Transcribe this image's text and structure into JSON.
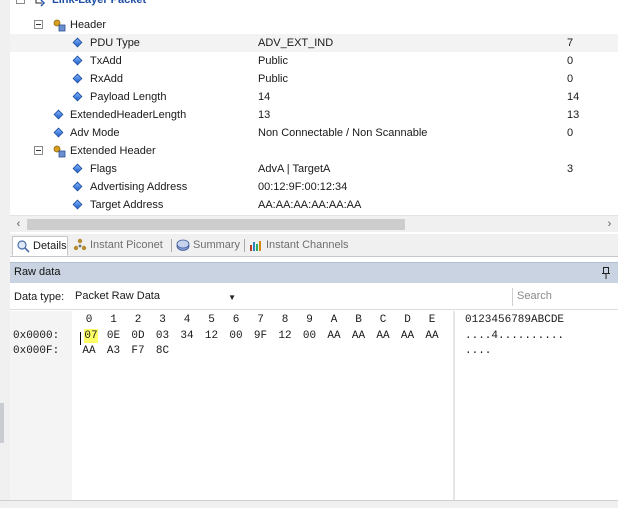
{
  "tree": {
    "title": "Link-Layer Packet",
    "rows": [
      {
        "id": "header",
        "name": "Header",
        "value": "",
        "raw": ""
      },
      {
        "id": "pdu-type",
        "name": "PDU Type",
        "value": "ADV_EXT_IND",
        "raw": "7"
      },
      {
        "id": "txadd",
        "name": "TxAdd",
        "value": "Public",
        "raw": "0"
      },
      {
        "id": "rxadd",
        "name": "RxAdd",
        "value": "Public",
        "raw": "0"
      },
      {
        "id": "payload-length",
        "name": "Payload Length",
        "value": "14",
        "raw": "14"
      },
      {
        "id": "ext-header-length",
        "name": "ExtendedHeaderLength",
        "value": "13",
        "raw": "13"
      },
      {
        "id": "adv-mode",
        "name": "Adv Mode",
        "value": "Non Connectable / Non Scannable",
        "raw": "0"
      },
      {
        "id": "extended-header",
        "name": "Extended Header",
        "value": "",
        "raw": ""
      },
      {
        "id": "flags",
        "name": "Flags",
        "value": "AdvA | TargetA",
        "raw": "3"
      },
      {
        "id": "advertising-address",
        "name": "Advertising Address",
        "value": "00:12:9F:00:12:34",
        "raw": ""
      },
      {
        "id": "target-address",
        "name": "Target Address",
        "value": "AA:AA:AA:AA:AA:AA",
        "raw": ""
      }
    ]
  },
  "scroll": {
    "left_arrow": "‹",
    "right_arrow": "›"
  },
  "tabs": [
    {
      "label": "Details",
      "icon": "details-icon",
      "active": true
    },
    {
      "label": "Instant Piconet",
      "icon": "piconet-icon",
      "active": false
    },
    {
      "label": "Summary",
      "icon": "summary-icon",
      "active": false
    },
    {
      "label": "Instant Channels",
      "icon": "channels-icon",
      "active": false
    }
  ],
  "raw_panel": {
    "title": "Raw data",
    "data_type_label": "Data type:",
    "data_type_value": "Packet Raw Data",
    "search_placeholder": "Search",
    "hex_header": [
      "0",
      "1",
      "2",
      "3",
      "4",
      "5",
      "6",
      "7",
      "8",
      "9",
      "A",
      "B",
      "C",
      "D",
      "E"
    ],
    "ascii_header": "0123456789ABCDE",
    "lines": [
      {
        "address": "0x0000:",
        "bytes": [
          "07",
          "0E",
          "0D",
          "03",
          "34",
          "12",
          "00",
          "9F",
          "12",
          "00",
          "AA",
          "AA",
          "AA",
          "AA",
          "AA"
        ],
        "ascii": "....4.........."
      },
      {
        "address": "0x000F:",
        "bytes": [
          "AA",
          "A3",
          "F7",
          "8C"
        ],
        "ascii": "...."
      }
    ],
    "highlight_color": "#ffff66"
  },
  "colors": {
    "accent": "#1f4fa5",
    "panel_header": "#c9d3e1"
  }
}
